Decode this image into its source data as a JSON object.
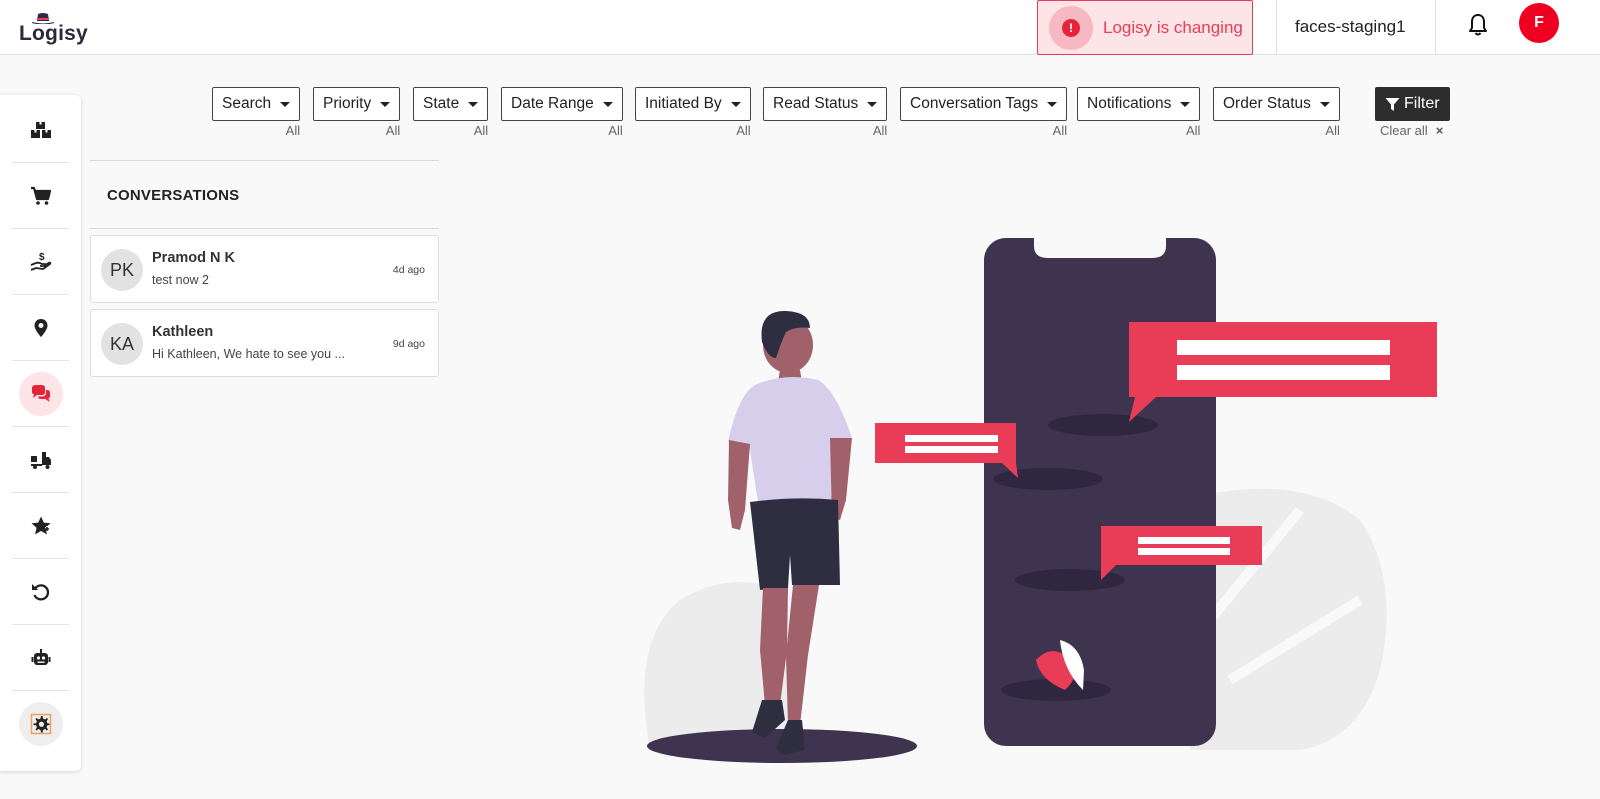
{
  "app": {
    "logo_text": "Logisy",
    "alert_text": "Logisy is changing",
    "alert_icon": "!",
    "workspace": "faces-staging1",
    "user_initial": "F",
    "accent": "#e93d57"
  },
  "sidebar": {
    "items": [
      {
        "icon": "boxes-icon"
      },
      {
        "icon": "cart-icon"
      },
      {
        "icon": "payment-hand-icon"
      },
      {
        "icon": "location-pin-icon"
      },
      {
        "icon": "chat-icon",
        "active": true
      },
      {
        "icon": "shipping-truck-icon"
      },
      {
        "icon": "star-icon"
      },
      {
        "icon": "undo-icon"
      },
      {
        "icon": "robot-icon"
      },
      {
        "icon": "settings-gear-icon"
      }
    ]
  },
  "filters": [
    {
      "label": "Search",
      "value": "All"
    },
    {
      "label": "Priority",
      "value": "All"
    },
    {
      "label": "State",
      "value": "All"
    },
    {
      "label": "Date Range",
      "value": "All"
    },
    {
      "label": "Initiated By",
      "value": "All"
    },
    {
      "label": "Read Status",
      "value": "All"
    },
    {
      "label": "Conversation Tags",
      "value": "All"
    },
    {
      "label": "Notifications",
      "value": "All"
    },
    {
      "label": "Order Status",
      "value": "All"
    }
  ],
  "filter_button": "Filter",
  "clear_all": "Clear all",
  "clear_icon": "×",
  "conversations": {
    "title": "CONVERSATIONS",
    "items": [
      {
        "initials": "PK",
        "name": "Pramod N K",
        "message": "test now 2",
        "time": "4d ago"
      },
      {
        "initials": "KA",
        "name": "Kathleen",
        "message": "Hi Kathleen, We hate to see you ...",
        "time": "9d ago"
      }
    ]
  }
}
